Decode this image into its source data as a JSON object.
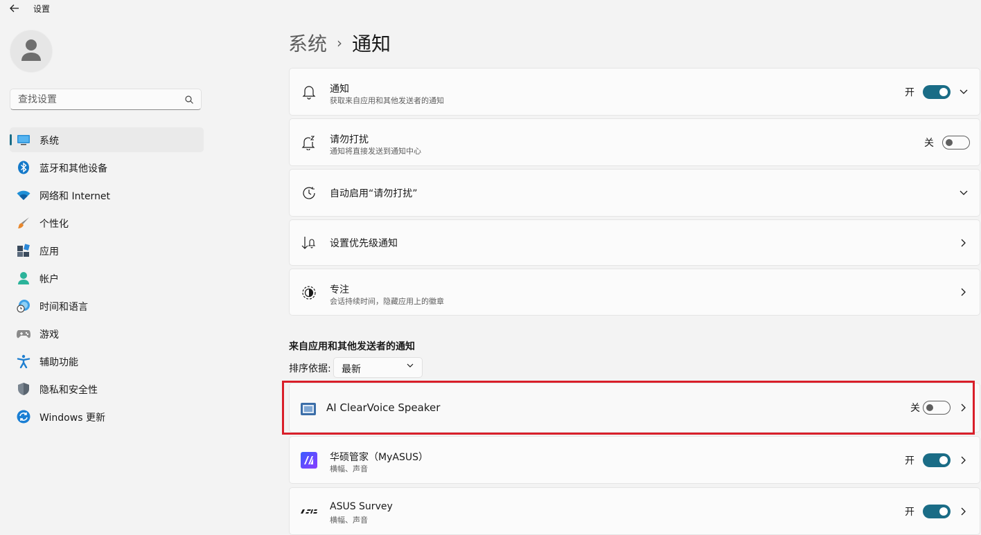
{
  "app": {
    "title": "设置"
  },
  "search": {
    "placeholder": "查找设置"
  },
  "sidebar": {
    "items": [
      {
        "label": "系统",
        "icon": "system-monitor-icon",
        "active": true
      },
      {
        "label": "蓝牙和其他设备",
        "icon": "bluetooth-icon"
      },
      {
        "label": "网络和 Internet",
        "icon": "wifi-icon"
      },
      {
        "label": "个性化",
        "icon": "paintbrush-icon"
      },
      {
        "label": "应用",
        "icon": "apps-icon"
      },
      {
        "label": "帐户",
        "icon": "account-icon"
      },
      {
        "label": "时间和语言",
        "icon": "globe-clock-icon"
      },
      {
        "label": "游戏",
        "icon": "gamepad-icon"
      },
      {
        "label": "辅助功能",
        "icon": "accessibility-icon"
      },
      {
        "label": "隐私和安全性",
        "icon": "shield-icon"
      },
      {
        "label": "Windows 更新",
        "icon": "windows-update-icon"
      }
    ]
  },
  "breadcrumb": {
    "parent": "系统",
    "separator": "›",
    "current": "通知"
  },
  "settings": [
    {
      "title": "通知",
      "subtitle": "获取来自应用和其他发送者的通知",
      "state": "开",
      "on": true,
      "icon": "bell-icon"
    },
    {
      "title": "请勿打扰",
      "subtitle": "通知将直接发送到通知中心",
      "state": "关",
      "on": false,
      "icon": "bell-snooze-icon"
    },
    {
      "title": "自动启用“请勿打扰”",
      "icon": "clock-icon"
    },
    {
      "title": "设置优先级通知",
      "icon": "priority-sort-icon"
    },
    {
      "title": "专注",
      "subtitle": "会话持续时间，隐藏应用上的徽章",
      "icon": "focus-icon"
    }
  ],
  "apps_section": {
    "title": "来自应用和其他发送者的通知",
    "sort_label": "排序依据:",
    "sort_value": "最新",
    "apps": [
      {
        "name": "AI ClearVoice Speaker",
        "state": "关",
        "on": false,
        "icon": "speaker-app-icon",
        "highlighted": true
      },
      {
        "name": "华硕管家（MyASUS）",
        "subtitle": "横幅、声音",
        "state": "开",
        "on": true,
        "icon": "myasus-icon"
      },
      {
        "name": "ASUS Survey",
        "subtitle": "横幅、声音",
        "state": "开",
        "on": true,
        "icon": "asus-logo-icon"
      }
    ]
  },
  "colors": {
    "accent": "#1a6c86",
    "highlight": "#d91f2a",
    "background": "#f3f3f3",
    "card": "#fbfbfb"
  }
}
